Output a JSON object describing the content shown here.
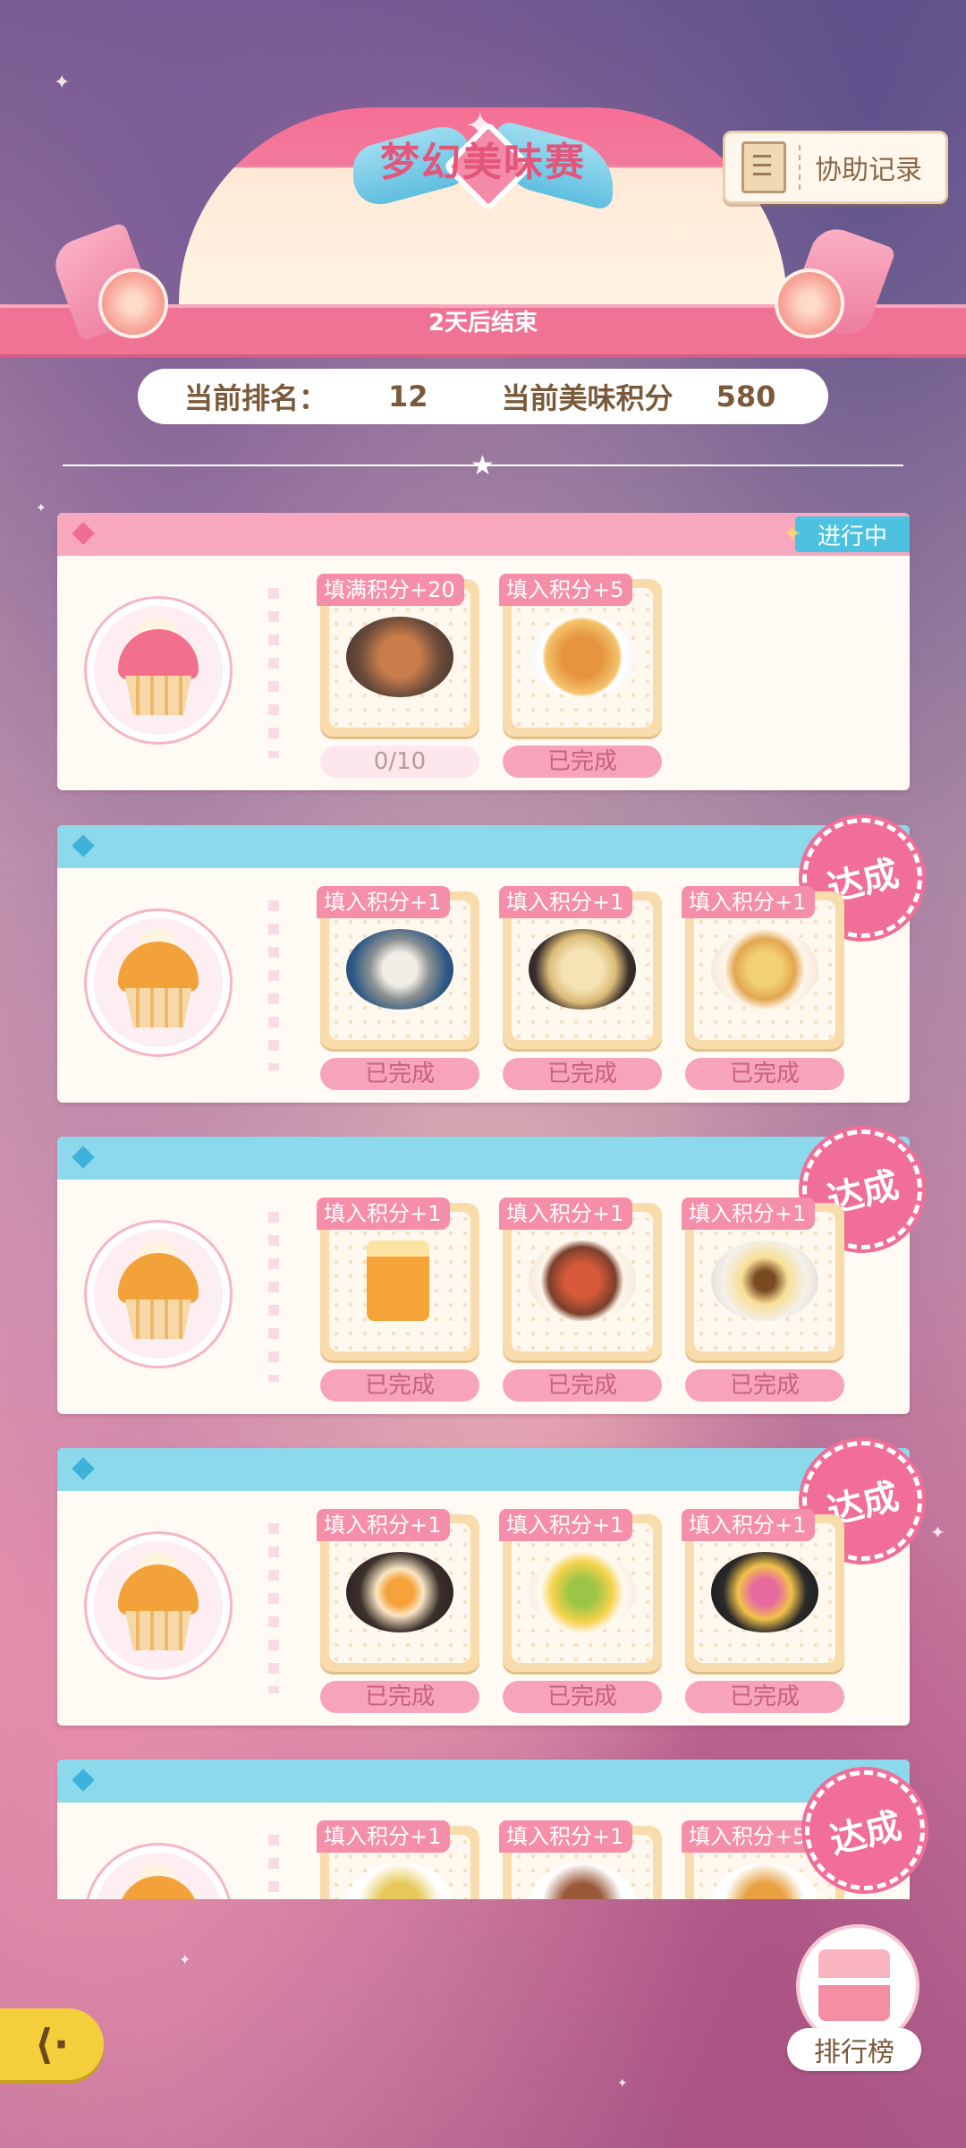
{
  "header": {
    "title": "梦幻美味赛",
    "countdown": "2天后结束",
    "assist_label": "协助记录"
  },
  "score": {
    "rank_label": "当前排名：",
    "rank_value": "12",
    "points_label": "当前美味积分",
    "points_value": "580"
  },
  "cards": [
    {
      "status": "进行中",
      "foods": [
        {
          "tag": "填满积分+20",
          "state": "0/10"
        },
        {
          "tag": "填入积分+5",
          "state": "已完成"
        }
      ]
    },
    {
      "stamp": "达成",
      "foods": [
        {
          "tag": "填入积分+1",
          "state": "已完成"
        },
        {
          "tag": "填入积分+1",
          "state": "已完成"
        },
        {
          "tag": "填入积分+1",
          "state": "已完成"
        }
      ]
    },
    {
      "stamp": "达成",
      "foods": [
        {
          "tag": "填入积分+1",
          "state": "已完成"
        },
        {
          "tag": "填入积分+1",
          "state": "已完成"
        },
        {
          "tag": "填入积分+1",
          "state": "已完成"
        }
      ]
    },
    {
      "stamp": "达成",
      "foods": [
        {
          "tag": "填入积分+1",
          "state": "已完成"
        },
        {
          "tag": "填入积分+1",
          "state": "已完成"
        },
        {
          "tag": "填入积分+1",
          "state": "已完成"
        }
      ]
    },
    {
      "stamp": "达成",
      "foods": [
        {
          "tag": "填入积分+1"
        },
        {
          "tag": "填入积分+1"
        },
        {
          "tag": "填入积分+5"
        }
      ]
    }
  ],
  "rank_button_label": "排行榜",
  "icons": {
    "back": "back-arrow-icon",
    "assist": "notebook-icon",
    "rank": "cake-icon"
  },
  "colors": {
    "accent_pink": "#f07396",
    "accent_blue": "#8dd9ec",
    "status_blue": "#4cc1e0",
    "done_pink": "#f6a3bb",
    "gold": "#f5cf3b"
  }
}
